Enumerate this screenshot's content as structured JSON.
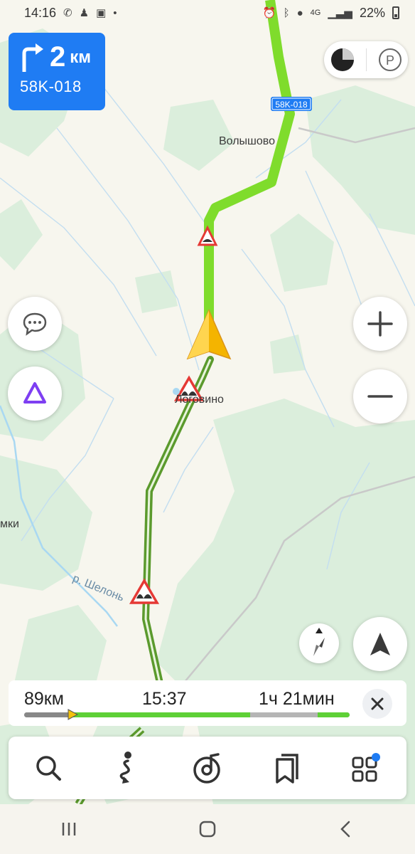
{
  "status_bar": {
    "time": "14:16",
    "network": "4G",
    "battery": "22%",
    "dot": "•"
  },
  "maneuver": {
    "distance": "2",
    "unit": "км",
    "road": "58K-018"
  },
  "map": {
    "labels": {
      "volyshovo": "Волышово",
      "logovino": "Логовино",
      "river": "р. Шелонь",
      "partial": "мки"
    },
    "road_sign": "58K-018",
    "colors": {
      "route_primary": "#7fdc2c",
      "route_secondary": "#5b9a2d",
      "water": "#a9d8f2",
      "forest": "#dbeedc"
    }
  },
  "trip": {
    "distance": "89км",
    "arrival": "15:37",
    "remaining": "1ч 21мин",
    "progress_fraction": 0.14,
    "colors": {
      "done": "#888888",
      "green": "#5ed036",
      "traffic_gray": "#b5b5b5"
    }
  },
  "toolbar": {
    "items": [
      {
        "name": "search-icon"
      },
      {
        "name": "route-icon"
      },
      {
        "name": "music-icon"
      },
      {
        "name": "bookmarks-icon"
      },
      {
        "name": "services-icon"
      }
    ]
  },
  "icons": {
    "chat": "chat-icon",
    "alice": "alice-icon",
    "zoom_in": "plus-icon",
    "zoom_out": "minus-icon",
    "compass": "compass-icon",
    "locate": "locate-arrow-icon",
    "parking": "parking-icon",
    "traffic": "traffic-layer-icon",
    "close": "close-icon"
  }
}
